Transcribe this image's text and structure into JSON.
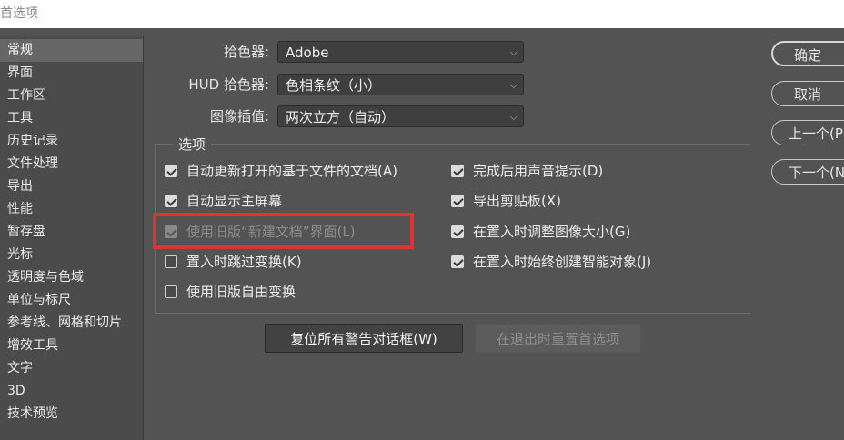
{
  "window": {
    "title": "首选项"
  },
  "sidebar": {
    "items": [
      {
        "label": "常规",
        "active": true
      },
      {
        "label": "界面"
      },
      {
        "label": "工作区"
      },
      {
        "label": "工具"
      },
      {
        "label": "历史记录"
      },
      {
        "label": "文件处理"
      },
      {
        "label": "导出"
      },
      {
        "label": "性能"
      },
      {
        "label": "暂存盘"
      },
      {
        "label": "光标"
      },
      {
        "label": "透明度与色域"
      },
      {
        "label": "单位与标尺"
      },
      {
        "label": "参考线、网格和切片"
      },
      {
        "label": "增效工具"
      },
      {
        "label": "文字"
      },
      {
        "label": "3D"
      },
      {
        "label": "技术预览"
      }
    ]
  },
  "settings": {
    "color_picker": {
      "label": "拾色器:",
      "value": "Adobe"
    },
    "hud_color_picker": {
      "label": "HUD 拾色器:",
      "value": "色相条纹（小）"
    },
    "image_interpolation": {
      "label": "图像插值:",
      "value": "两次立方（自动）"
    }
  },
  "options": {
    "title": "选项",
    "left": [
      {
        "label": "自动更新打开的基于文件的文档(A)",
        "checked": true,
        "disabled": false
      },
      {
        "label": "自动显示主屏幕",
        "checked": true,
        "disabled": false
      },
      {
        "label": "使用旧版“新建文档”界面(L)",
        "checked": true,
        "disabled": true
      },
      {
        "label": "置入时跳过变换(K)",
        "checked": false,
        "disabled": false
      },
      {
        "label": "使用旧版自由变换",
        "checked": false,
        "disabled": false
      }
    ],
    "right": [
      {
        "label": "完成后用声音提示(D)",
        "checked": true
      },
      {
        "label": "导出剪贴板(X)",
        "checked": true
      },
      {
        "label": "在置入时调整图像大小(G)",
        "checked": true
      },
      {
        "label": "在置入时始终创建智能对象(J)",
        "checked": true
      }
    ]
  },
  "buttons": {
    "reset_warnings": "复位所有警告对话框(W)",
    "reset_on_quit": "在退出时重置首选项",
    "ok": "确定",
    "cancel": "取消",
    "prev": "上一个(P)",
    "next": "下一个(N)"
  },
  "colors": {
    "highlight": "#e0322e",
    "background": "#535353"
  }
}
